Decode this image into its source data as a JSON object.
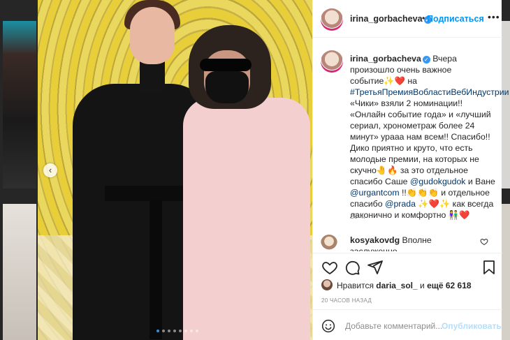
{
  "header": {
    "username": "irina_gorbacheva",
    "separator": "•",
    "follow_label": "Подписаться",
    "more_label": "•••"
  },
  "caption": {
    "username": "irina_gorbacheva",
    "segments": [
      {
        "text": " Вчера произошло очень важное событие✨❤️ на ",
        "type": "text"
      },
      {
        "text": "#ТретьяПремияВобластиВебИндустрии",
        "type": "link"
      },
      {
        "text": " «Чики» взяли 2 номинации!! «Онлайн событие года» и «лучший сериал, хронометраж более 24 минут» урааа нам всем!! Спасибо!! Дико приятно и круто, что есть молодые премии, на которых не скучно🤚🔥 за это отдельное спасибо Саше ",
        "type": "text"
      },
      {
        "text": "@gudokgudok",
        "type": "link"
      },
      {
        "text": " и Ване ",
        "type": "text"
      },
      {
        "text": "@urgantcom",
        "type": "link"
      },
      {
        "text": " !!👏👏👏 и отдельное спасибо ",
        "type": "text"
      },
      {
        "text": "@prada",
        "type": "link"
      },
      {
        "text": " ✨❤️✨ как всегда лаконично и комфортно 👫❤️",
        "type": "text"
      }
    ],
    "time": "20 ч."
  },
  "comment": {
    "username": "kosyakovdg",
    "text": " Вполне заслуженно"
  },
  "likes": {
    "prefix": "Нравится",
    "user": "daria_sol_",
    "middle": "и",
    "others": "ещё 62 618"
  },
  "timestamp": "20 ЧАСОВ НАЗАД",
  "add_comment": {
    "placeholder": "Добавьте комментарий...",
    "publish_label": "Опубликовать"
  },
  "carousel": {
    "prev_label": "‹",
    "slide_count": 8,
    "active_index": 0
  },
  "colors": {
    "accent": "#0095f6",
    "link": "#00376b",
    "muted": "#8e8e8e",
    "publish_disabled": "#b2dffc"
  },
  "icons": [
    "heart-icon",
    "comment-icon",
    "share-icon",
    "bookmark-icon",
    "emoji-icon",
    "verified-icon",
    "chevron-left-icon"
  ]
}
